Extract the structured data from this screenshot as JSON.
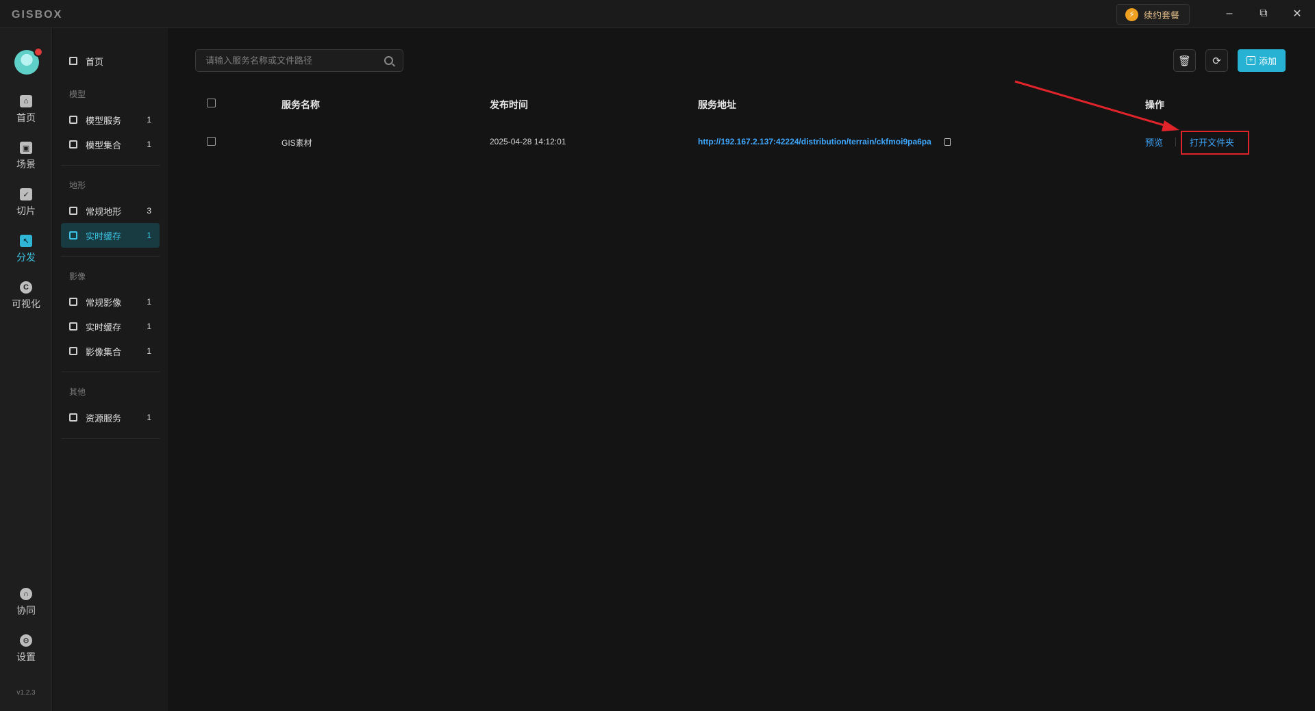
{
  "titlebar": {
    "logo": "GISBOX",
    "renew_label": "续约套餐",
    "minimize": "–",
    "restore": "⧉",
    "close": "✕"
  },
  "rail": {
    "items": [
      {
        "label": "首页",
        "icon": "home-icon"
      },
      {
        "label": "场景",
        "icon": "scene-icon"
      },
      {
        "label": "切片",
        "icon": "slice-icon"
      },
      {
        "label": "分发",
        "icon": "distribute-icon"
      },
      {
        "label": "可视化",
        "icon": "visualize-icon"
      }
    ],
    "bottom_items": [
      {
        "label": "协同",
        "icon": "lock-icon"
      },
      {
        "label": "设置",
        "icon": "gear-icon"
      }
    ],
    "version": "v1.2.3"
  },
  "sidebar": {
    "home": "首页",
    "groups": [
      {
        "title": "模型",
        "items": [
          {
            "name": "模型服务",
            "count": "1"
          },
          {
            "name": "模型集合",
            "count": "1"
          }
        ]
      },
      {
        "title": "地形",
        "items": [
          {
            "name": "常规地形",
            "count": "3"
          },
          {
            "name": "实时缓存",
            "count": "1"
          }
        ]
      },
      {
        "title": "影像",
        "items": [
          {
            "name": "常规影像",
            "count": "1"
          },
          {
            "name": "实时缓存",
            "count": "1"
          },
          {
            "name": "影像集合",
            "count": "1"
          }
        ]
      },
      {
        "title": "其他",
        "items": [
          {
            "name": "资源服务",
            "count": "1"
          }
        ]
      }
    ]
  },
  "toolbar": {
    "search_placeholder": "请输入服务名称或文件路径",
    "add_label": "添加"
  },
  "table": {
    "headers": {
      "name": "服务名称",
      "time": "发布时间",
      "url": "服务地址",
      "ops": "操作"
    },
    "rows": [
      {
        "name": "GIS素材",
        "time": "2025-04-28 14:12:01",
        "url": "http://192.167.2.137:42224/distribution/terrain/ckfmoi9pa6pa",
        "preview": "预览",
        "open_folder": "打开文件夹"
      }
    ]
  },
  "colors": {
    "accent": "#27b2d3",
    "link": "#3fa8ff",
    "annotation": "#e0242a"
  }
}
